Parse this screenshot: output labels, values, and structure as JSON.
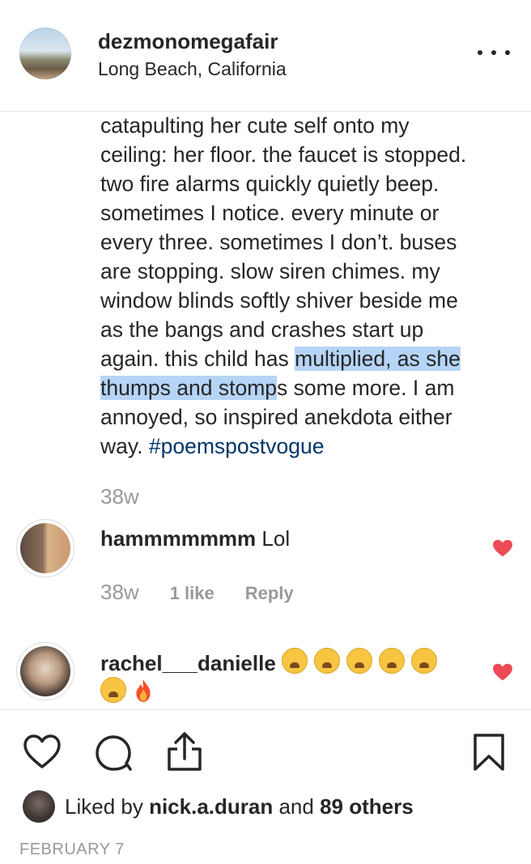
{
  "post": {
    "username": "dezmonomegafair",
    "location": "Long Beach, California",
    "caption": {
      "line1": "catapulting her cute self onto my",
      "line2": "ceiling: her floor. the faucet is stopped.",
      "line3": "two fire alarms quickly quietly beep.",
      "line4": "sometimes I notice. every minute or",
      "line5": "every three. sometimes I don’t. buses",
      "line6": "are stopping. slow siren chimes. my",
      "line7": "window blinds softly shiver beside me",
      "line8": "as the bangs and crashes start up",
      "line9_pre": "again. this child has ",
      "line9_hl": "multiplied, as she",
      "line10_hl": "thumps and stomp",
      "line10_post": "s some more. I am",
      "line11": "annoyed, so inspired anekdota either",
      "line12_pre": "way. ",
      "hashtag": "#poemspostvogue"
    },
    "age": "38w"
  },
  "comments": [
    {
      "username": "hammmmmmm",
      "text": " Lol",
      "age": "38w",
      "likes": "1 like",
      "reply": "Reply"
    },
    {
      "username": "rachel___danielle",
      "emoji_sequence": "😩 😩 😩 😩 😩 😩 🔥"
    }
  ],
  "actions": {
    "liked_by_prefix": "Liked by ",
    "liked_by_user": "nick.a.duran",
    "liked_and": " and ",
    "liked_others": "89 others",
    "date": "FEBRUARY 7"
  },
  "colors": {
    "highlight": "#b6d4f6",
    "hashtag": "#003569",
    "heart": "#ed4956",
    "muted": "#999999"
  }
}
